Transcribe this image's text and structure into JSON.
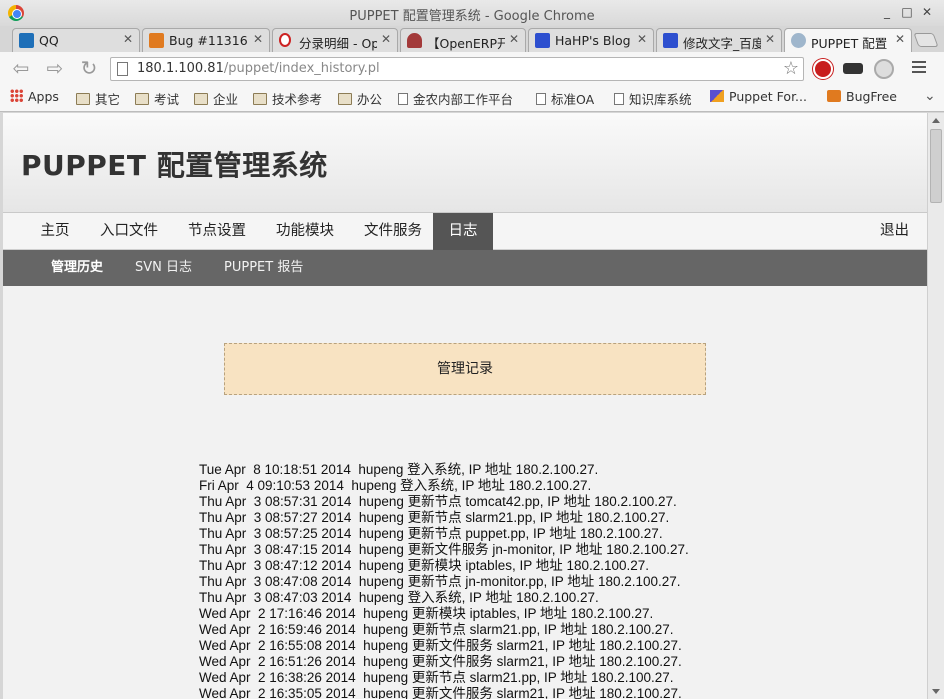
{
  "window": {
    "title": "PUPPET 配置管理系统 - Google Chrome"
  },
  "tabs": [
    {
      "label": "QQ",
      "favicon": "qq-favicon",
      "color": "#1e6fb8"
    },
    {
      "label": "Bug #11316",
      "favicon": "bugfree-favicon",
      "color": "#e07a1f"
    },
    {
      "label": "分录明细 - Op",
      "favicon": "opera-favicon",
      "color": "#cc2222"
    },
    {
      "label": "【OpenERP开",
      "favicon": "openerp-favicon",
      "color": "#a33a3a"
    },
    {
      "label": "HaHP's Blog",
      "favicon": "paw-favicon",
      "color": "#2d4fcf"
    },
    {
      "label": "修改文字_百度",
      "favicon": "baidu-favicon",
      "color": "#2d4fcf"
    },
    {
      "label": "PUPPET 配置",
      "favicon": "globe-favicon",
      "color": "#7b9ab8"
    }
  ],
  "toolbar": {
    "url_host": "180.1.100.81",
    "url_path": "/puppet/index_history.pl"
  },
  "bookmarks": [
    {
      "label": "Apps",
      "icon": "apps-grid-icon"
    },
    {
      "label": "其它",
      "icon": "folder-icon"
    },
    {
      "label": "考试",
      "icon": "folder-icon"
    },
    {
      "label": "企业",
      "icon": "folder-icon"
    },
    {
      "label": "技术参考",
      "icon": "folder-icon"
    },
    {
      "label": "办公",
      "icon": "folder-icon"
    },
    {
      "label": "金农内部工作平台",
      "icon": "page-icon"
    },
    {
      "label": "标准OA",
      "icon": "page-icon"
    },
    {
      "label": "知识库系统",
      "icon": "page-icon"
    },
    {
      "label": "Puppet For...",
      "icon": "puppet-icon"
    },
    {
      "label": "BugFree",
      "icon": "bugfree-icon"
    }
  ],
  "site": {
    "title": "PUPPET 配置管理系统",
    "nav": [
      "主页",
      "入口文件",
      "节点设置",
      "功能模块",
      "文件服务",
      "日志"
    ],
    "nav_active": "日志",
    "logout": "退出",
    "subnav": [
      "管理历史",
      "SVN 日志",
      "PUPPET 报告"
    ],
    "subnav_active": "管理历史",
    "notice": "管理记录"
  },
  "logs": [
    "Tue Apr  8 10:18:51 2014  hupeng 登入系统, IP 地址 180.2.100.27.",
    "Fri Apr  4 09:10:53 2014  hupeng 登入系统, IP 地址 180.2.100.27.",
    "Thu Apr  3 08:57:31 2014  hupeng 更新节点 tomcat42.pp, IP 地址 180.2.100.27.",
    "Thu Apr  3 08:57:27 2014  hupeng 更新节点 slarm21.pp, IP 地址 180.2.100.27.",
    "Thu Apr  3 08:57:25 2014  hupeng 更新节点 puppet.pp, IP 地址 180.2.100.27.",
    "Thu Apr  3 08:47:15 2014  hupeng 更新文件服务 jn-monitor, IP 地址 180.2.100.27.",
    "Thu Apr  3 08:47:12 2014  hupeng 更新模块 iptables, IP 地址 180.2.100.27.",
    "Thu Apr  3 08:47:08 2014  hupeng 更新节点 jn-monitor.pp, IP 地址 180.2.100.27.",
    "Thu Apr  3 08:47:03 2014  hupeng 登入系统, IP 地址 180.2.100.27.",
    "Wed Apr  2 17:16:46 2014  hupeng 更新模块 iptables, IP 地址 180.2.100.27.",
    "Wed Apr  2 16:59:46 2014  hupeng 更新节点 slarm21.pp, IP 地址 180.2.100.27.",
    "Wed Apr  2 16:55:08 2014  hupeng 更新文件服务 slarm21, IP 地址 180.2.100.27.",
    "Wed Apr  2 16:51:26 2014  hupeng 更新文件服务 slarm21, IP 地址 180.2.100.27.",
    "Wed Apr  2 16:38:26 2014  hupeng 更新节点 slarm21.pp, IP 地址 180.2.100.27.",
    "Wed Apr  2 16:35:05 2014  hupeng 更新文件服务 slarm21, IP 地址 180.2.100.27."
  ]
}
